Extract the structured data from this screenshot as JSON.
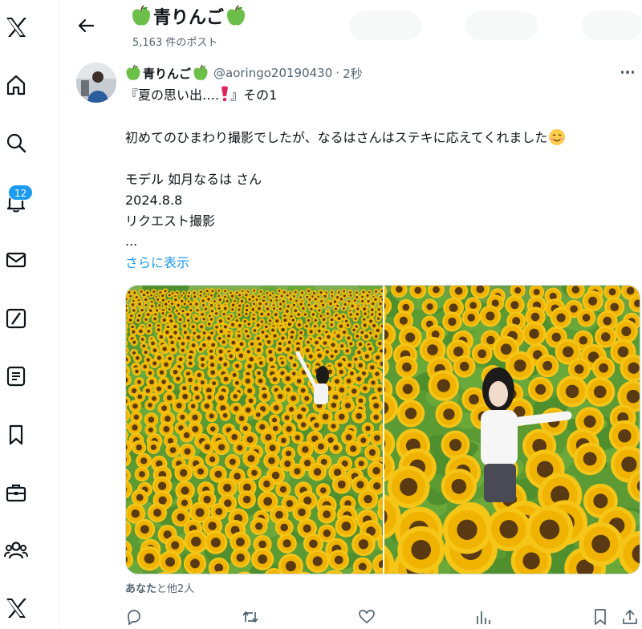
{
  "nav": {
    "items": [
      {
        "icon": "x-logo-icon"
      },
      {
        "icon": "home-icon"
      },
      {
        "icon": "search-icon"
      },
      {
        "icon": "notifications-bell-icon",
        "badge": "12"
      },
      {
        "icon": "messages-envelope-icon"
      },
      {
        "icon": "grok-slash-icon"
      },
      {
        "icon": "lists-icon"
      },
      {
        "icon": "bookmarks-icon"
      },
      {
        "icon": "jobs-briefcase-icon"
      },
      {
        "icon": "communities-icon"
      },
      {
        "icon": "premium-x-icon"
      }
    ]
  },
  "header": {
    "title": "青りんご",
    "post_count": "5,163 件のポスト"
  },
  "tweet": {
    "display_name": "青りんご",
    "handle": "@aoringo20190430",
    "separator": "·",
    "time": "2秒",
    "lines": [
      "『夏の思い出….",
      "』その1",
      "初めてのひまわり撮影でしたが、なるはさんはステキに応えてくれました",
      "モデル 如月なるは さん",
      "2024.8.8",
      "リクエスト撮影",
      "..."
    ],
    "show_more": "さらに表示",
    "liked_by_you": "あなた",
    "liked_by_others": "と他2人"
  },
  "colors": {
    "accent": "#1d9bf0",
    "text": "#0f1419",
    "secondary": "#536471",
    "apple_green": "#6cc04a",
    "sunflower": "#f5c518"
  },
  "actions": [
    "reply-icon",
    "repost-icon",
    "like-icon",
    "views-icon",
    "bookmark-icon",
    "share-icon"
  ]
}
